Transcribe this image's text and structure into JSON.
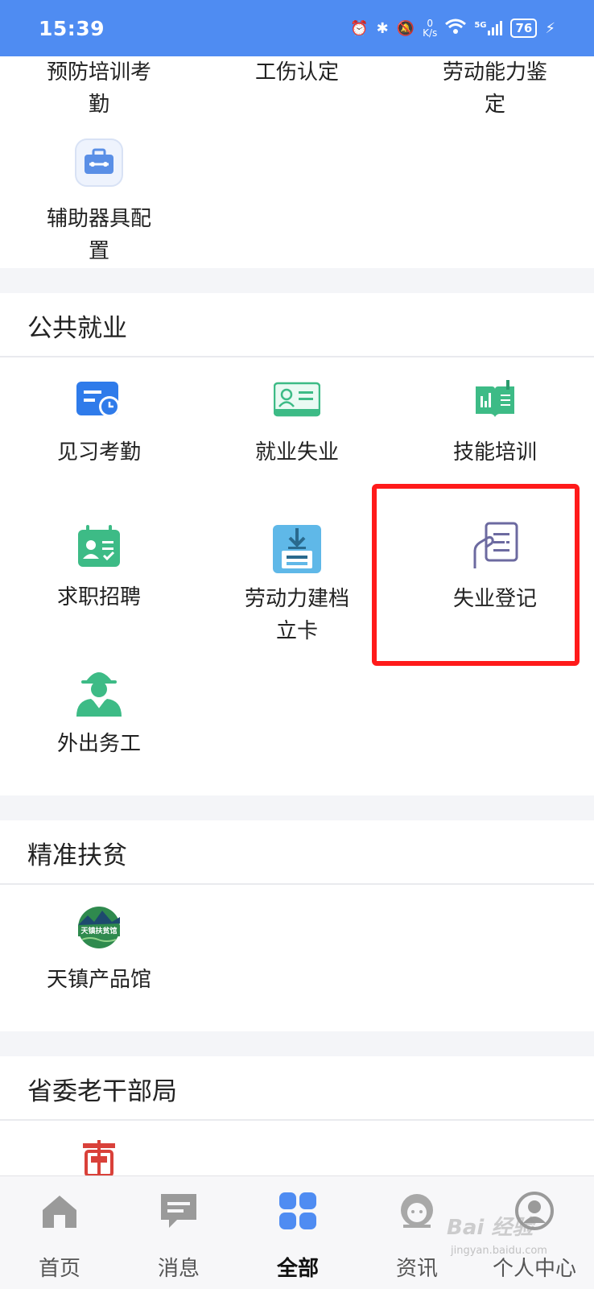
{
  "status_bar": {
    "time": "15:39",
    "net_speed_value": "0",
    "net_speed_unit": "K/s",
    "network": "5G",
    "battery": "76"
  },
  "top_section": {
    "items": [
      {
        "label": "预防培训考勤"
      },
      {
        "label": "工伤认定"
      },
      {
        "label": "劳动能力鉴定"
      },
      {
        "label": "辅助器具配置",
        "icon": "toolbox-icon"
      }
    ]
  },
  "public_employment": {
    "title": "公共就业",
    "items": [
      {
        "label": "见习考勤",
        "icon": "attendance-card-icon"
      },
      {
        "label": "就业失业",
        "icon": "id-card-icon"
      },
      {
        "label": "技能培训",
        "icon": "book-icon"
      },
      {
        "label": "求职招聘",
        "icon": "job-calendar-icon"
      },
      {
        "label": "劳动力建档立卡",
        "icon": "archive-download-icon"
      },
      {
        "label": "失业登记",
        "icon": "document-hand-icon"
      },
      {
        "label": "外出务工",
        "icon": "worker-icon"
      }
    ]
  },
  "poverty_alleviation": {
    "title": "精准扶贫",
    "items": [
      {
        "label": "天镇产品馆",
        "icon": "tianzhen-logo-icon",
        "logo_text": "天镇扶贫馆"
      }
    ]
  },
  "veteran_cadres": {
    "title": "省委老干部局",
    "items": [
      {
        "icon": "red-emblem-icon"
      }
    ]
  },
  "tabbar": {
    "tabs": [
      {
        "label": "首页",
        "icon": "home-icon"
      },
      {
        "label": "消息",
        "icon": "message-icon"
      },
      {
        "label": "全部",
        "icon": "grid-icon",
        "active": true
      },
      {
        "label": "资讯",
        "icon": "news-avatar-icon"
      },
      {
        "label": "个人中心",
        "icon": "user-icon"
      }
    ]
  },
  "watermark": {
    "text": "Bai 经验",
    "sub": "jingyan.baidu.com"
  },
  "colors": {
    "status_bar": "#4f8cf2",
    "highlight": "#ff1a1a",
    "active_tab_icon": "#4f8cf2",
    "green": "#3dbb86",
    "purple": "#6c6aa0"
  }
}
